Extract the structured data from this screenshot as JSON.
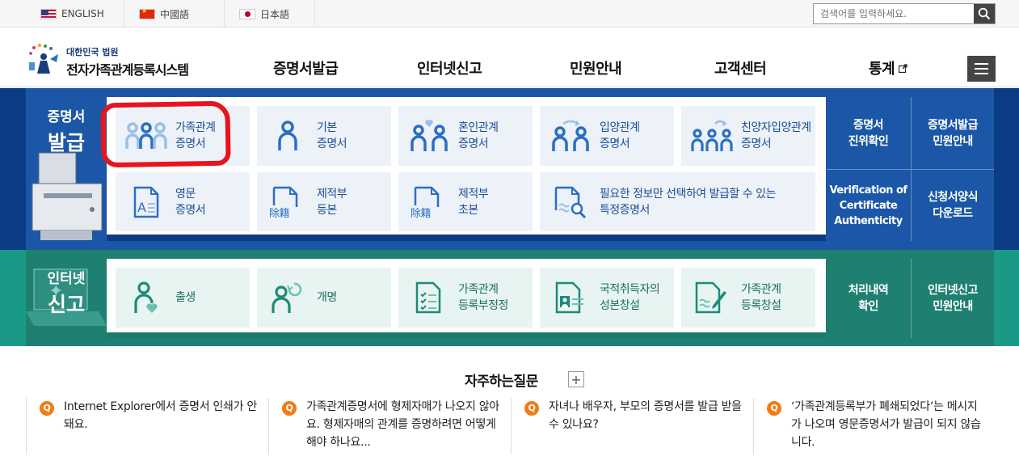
{
  "topbar": {
    "languages": [
      {
        "label": "ENGLISH",
        "flag": "us-flag-icon"
      },
      {
        "label": "中國語",
        "flag": "china-flag-icon"
      },
      {
        "label": "日本語",
        "flag": "japan-flag-icon"
      }
    ],
    "search_placeholder": "검색어를 입력하세요."
  },
  "logo": {
    "sub": "대한민국 법원",
    "main": "전자가족관계등록시스템"
  },
  "nav": [
    "증명서발급",
    "인터넷신고",
    "민원안내",
    "고객센터",
    "통계"
  ],
  "certificate": {
    "title_line1": "증명서",
    "title_line2": "발급",
    "tiles": [
      {
        "line1": "가족관계",
        "line2": "증명서"
      },
      {
        "line1": "기본",
        "line2": "증명서"
      },
      {
        "line1": "혼인관계",
        "line2": "증명서"
      },
      {
        "line1": "입양관계",
        "line2": "증명서"
      },
      {
        "line1": "친양자입양관계",
        "line2": "증명서"
      },
      {
        "line1": "영문",
        "line2": "증명서"
      },
      {
        "line1": "제적부",
        "line2": "등본"
      },
      {
        "line1": "제적부",
        "line2": "초본"
      },
      {
        "line1": "필요한 정보만 선택하여 발급할 수 있는",
        "line2": "특정증명서"
      }
    ],
    "side": [
      {
        "line1": "증명서",
        "line2": "진위확인"
      },
      {
        "line1": "증명서발급",
        "line2": "민원안내"
      },
      {
        "line1": "Verification of",
        "line2": "Certificate",
        "line3": "Authenticity"
      },
      {
        "line1": "신청서양식",
        "line2": "다운로드"
      }
    ],
    "icon_text": "除籍"
  },
  "report": {
    "title_line1": "인터넷",
    "title_line2": "신고",
    "tiles": [
      {
        "line1": "출생",
        "line2": ""
      },
      {
        "line1": "개명",
        "line2": ""
      },
      {
        "line1": "가족관계",
        "line2": "등록부정정"
      },
      {
        "line1": "국적취득자의",
        "line2": "성본창설"
      },
      {
        "line1": "가족관계",
        "line2": "등록창설"
      }
    ],
    "side": [
      {
        "line1": "처리내역",
        "line2": "확인"
      },
      {
        "line1": "인터넷신고",
        "line2": "민원안내"
      }
    ]
  },
  "faq": {
    "title": "자주하는질문",
    "plus": "+",
    "q_badge": "Q",
    "items": [
      {
        "text": "Internet Explorer에서 증명서 인쇄가 안돼요."
      },
      {
        "text": "가족관계증명서에 형제자매가 나오지 않아요. 형제자매의 관계를 증명하려면 어떻게 해야 하나요..."
      },
      {
        "text": "자녀나 배우자, 부모의 증명서를 발급 받을 수 있나요?"
      },
      {
        "text": "‘가족관계등록부가 폐쇄되었다’는 메시지가 나오며 영문증명서가 발급이 되지 않습니다."
      }
    ]
  },
  "colors": {
    "blue_dark": "#0b3c84",
    "blue": "#1b57a6",
    "green_dark": "#1f7f71",
    "green": "#1a9a86",
    "highlight": "#e8141d",
    "faq_badge": "#f07c13"
  }
}
